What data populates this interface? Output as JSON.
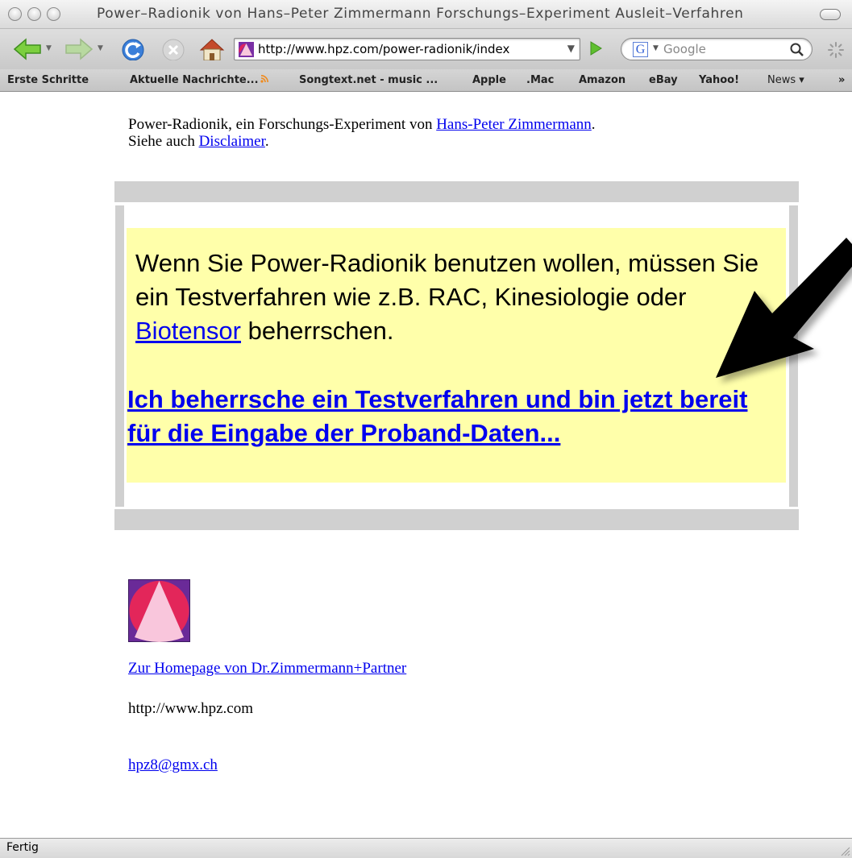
{
  "window": {
    "title": "Power–Radionik von Hans–Peter Zimmermann Forschungs–Experiment Ausleit–Verfahren"
  },
  "toolbar": {
    "url": "http://www.hpz.com/power-radionik/index",
    "search_placeholder": "Google"
  },
  "bookmarks": [
    "Erste Schritte",
    "Aktuelle Nachrichte...",
    "Songtext.net - music ...",
    "Apple",
    ".Mac",
    "Amazon",
    "eBay",
    "Yahoo!",
    "News ▾",
    "»"
  ],
  "page": {
    "intro_prefix": "Power-Radionik, ein Forschungs-Experiment von ",
    "intro_author_link": "Hans-Peter Zimmermann",
    "intro_suffix": ".",
    "see_also_prefix": "Siehe auch ",
    "disclaimer_link": "Disclaimer",
    "see_also_suffix": ".",
    "notice_text_1": "Wenn Sie Power-Radionik benutzen wollen, müssen Sie ein Testverfahren wie z.B. RAC, Kinesiologie oder ",
    "notice_biotensor_link": "Biotensor",
    "notice_text_2": " beherrschen.",
    "cta_link": "Ich beherrsche ein Testverfahren und bin jetzt bereit für die Eingabe der Proband-Daten...",
    "homepage_link": "Zur Homepage von Dr.Zimmermann+Partner",
    "homepage_url": "http://www.hpz.com",
    "email_link": "hpz8@gmx.ch"
  },
  "status": {
    "text": "Fertig"
  }
}
